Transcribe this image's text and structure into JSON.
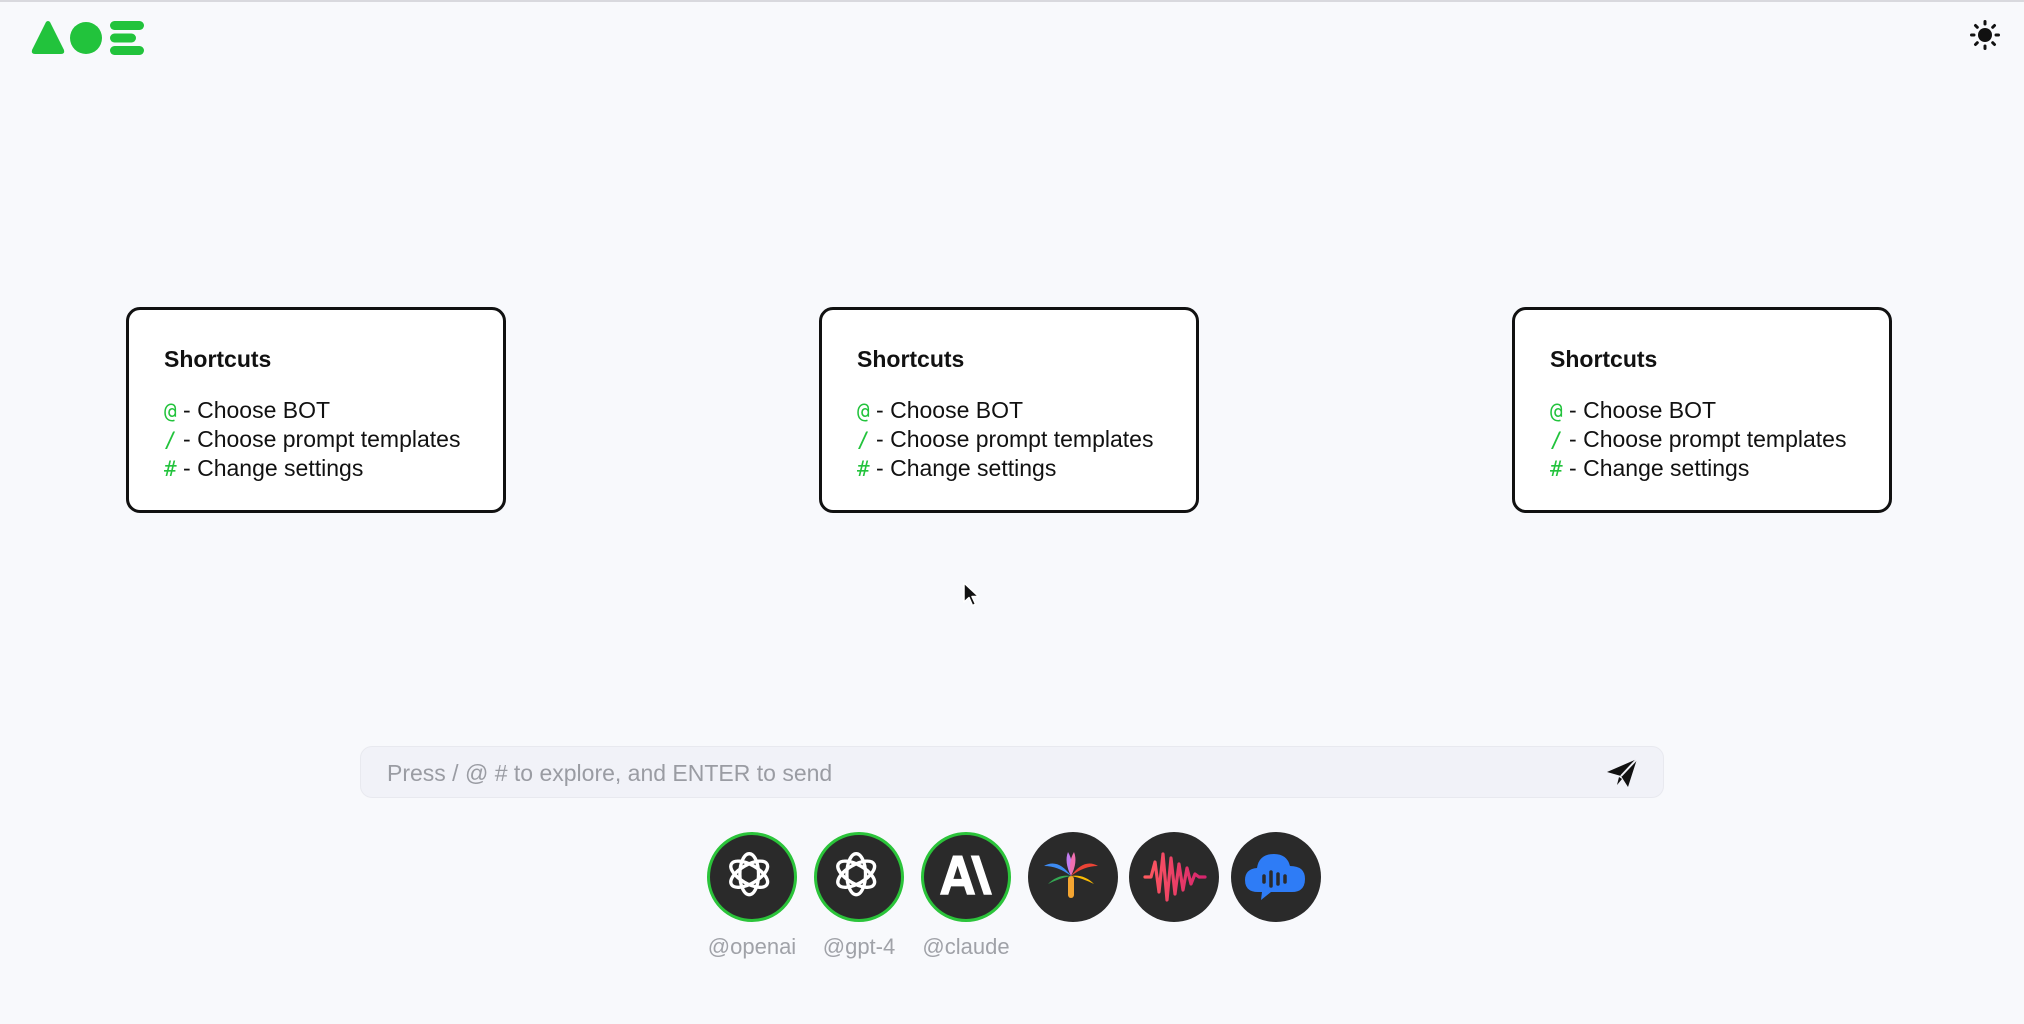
{
  "app": {
    "logo_icon": "aoe-logo",
    "theme_icon": "sun-icon",
    "brand_color": "#22c33c"
  },
  "cards": [
    {
      "title": "Shortcuts",
      "items": [
        {
          "key": "@",
          "text": " - Choose BOT"
        },
        {
          "key": "/",
          "text": " - Choose prompt templates"
        },
        {
          "key": "#",
          "text": " - Change settings"
        }
      ]
    },
    {
      "title": "Shortcuts",
      "items": [
        {
          "key": "@",
          "text": " - Choose BOT"
        },
        {
          "key": "/",
          "text": " - Choose prompt templates"
        },
        {
          "key": "#",
          "text": " - Change settings"
        }
      ]
    },
    {
      "title": "Shortcuts",
      "items": [
        {
          "key": "@",
          "text": " - Choose BOT"
        },
        {
          "key": "/",
          "text": " - Choose prompt templates"
        },
        {
          "key": "#",
          "text": " - Change settings"
        }
      ]
    }
  ],
  "chat": {
    "placeholder": "Press / @ # to explore, and ENTER to send",
    "value": "",
    "send_icon": "paper-plane-icon"
  },
  "bots": [
    {
      "icon": "openai-icon",
      "label": "@openai",
      "selected": true
    },
    {
      "icon": "openai-icon",
      "label": "@gpt-4",
      "selected": true
    },
    {
      "icon": "anthropic-icon",
      "label": "@claude",
      "selected": true
    },
    {
      "icon": "palm-icon",
      "label": "",
      "selected": false
    },
    {
      "icon": "soundwave-icon",
      "label": "",
      "selected": false
    },
    {
      "icon": "cloud-chat-icon",
      "label": "",
      "selected": false
    }
  ]
}
